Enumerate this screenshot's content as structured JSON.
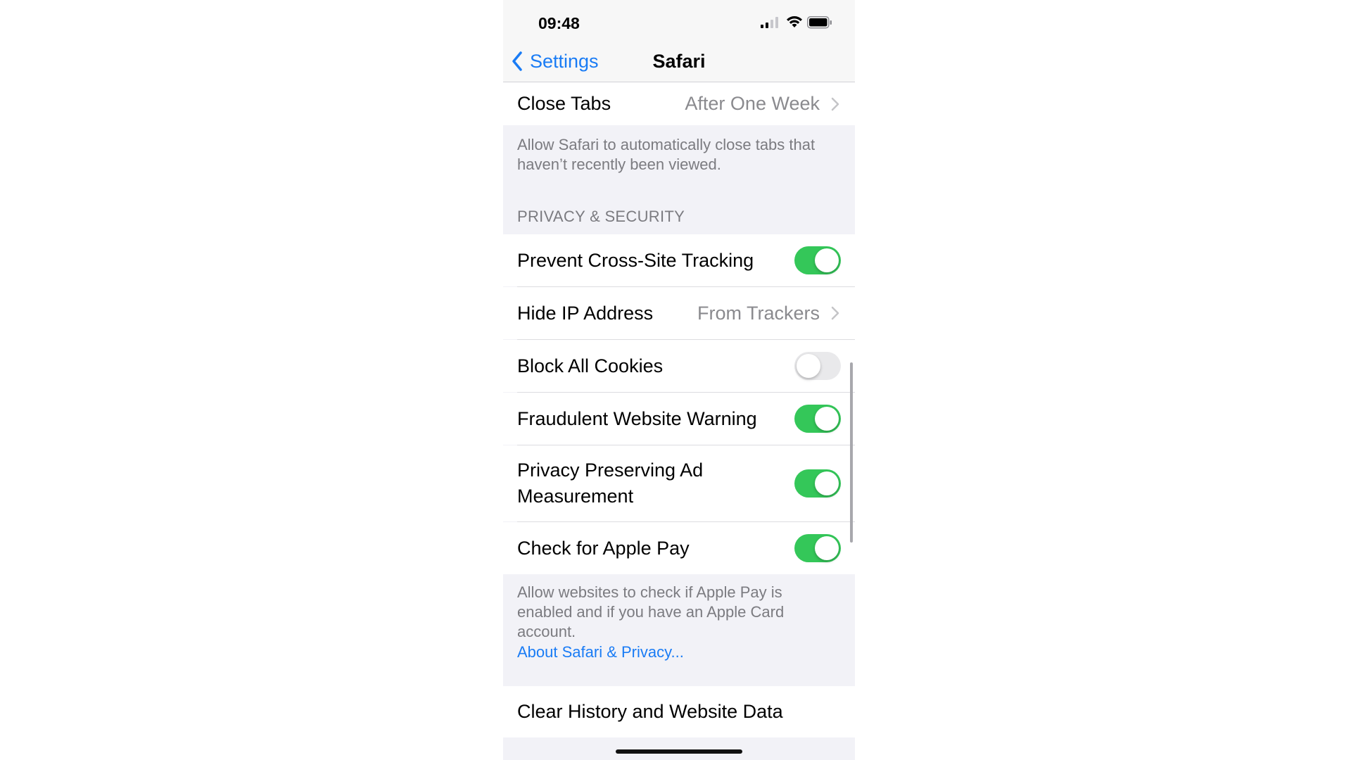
{
  "status_bar": {
    "time": "09:48"
  },
  "nav": {
    "back_label": "Settings",
    "title": "Safari"
  },
  "close_tabs": {
    "label": "Close Tabs",
    "value": "After One Week",
    "footer": "Allow Safari to automatically close tabs that haven’t recently been viewed."
  },
  "privacy": {
    "header": "PRIVACY & SECURITY",
    "rows": [
      {
        "label": "Prevent Cross-Site Tracking",
        "type": "toggle",
        "on": true
      },
      {
        "label": "Hide IP Address",
        "type": "link",
        "value": "From Trackers"
      },
      {
        "label": "Block All Cookies",
        "type": "toggle",
        "on": false
      },
      {
        "label": "Fraudulent Website Warning",
        "type": "toggle",
        "on": true
      },
      {
        "label": "Privacy Preserving Ad Measurement",
        "type": "toggle",
        "on": true
      },
      {
        "label": "Check for Apple Pay",
        "type": "toggle",
        "on": true
      }
    ],
    "footer": "Allow websites to check if Apple Pay is enabled and if you have an Apple Card account.",
    "footer_link": "About Safari & Privacy..."
  },
  "clear_history": {
    "label": "Clear History and Website Data"
  },
  "colors": {
    "accent": "#1a7cf5",
    "toggle_on": "#34c759",
    "toggle_off": "#e9e9eb",
    "background": "#f2f2f7"
  }
}
